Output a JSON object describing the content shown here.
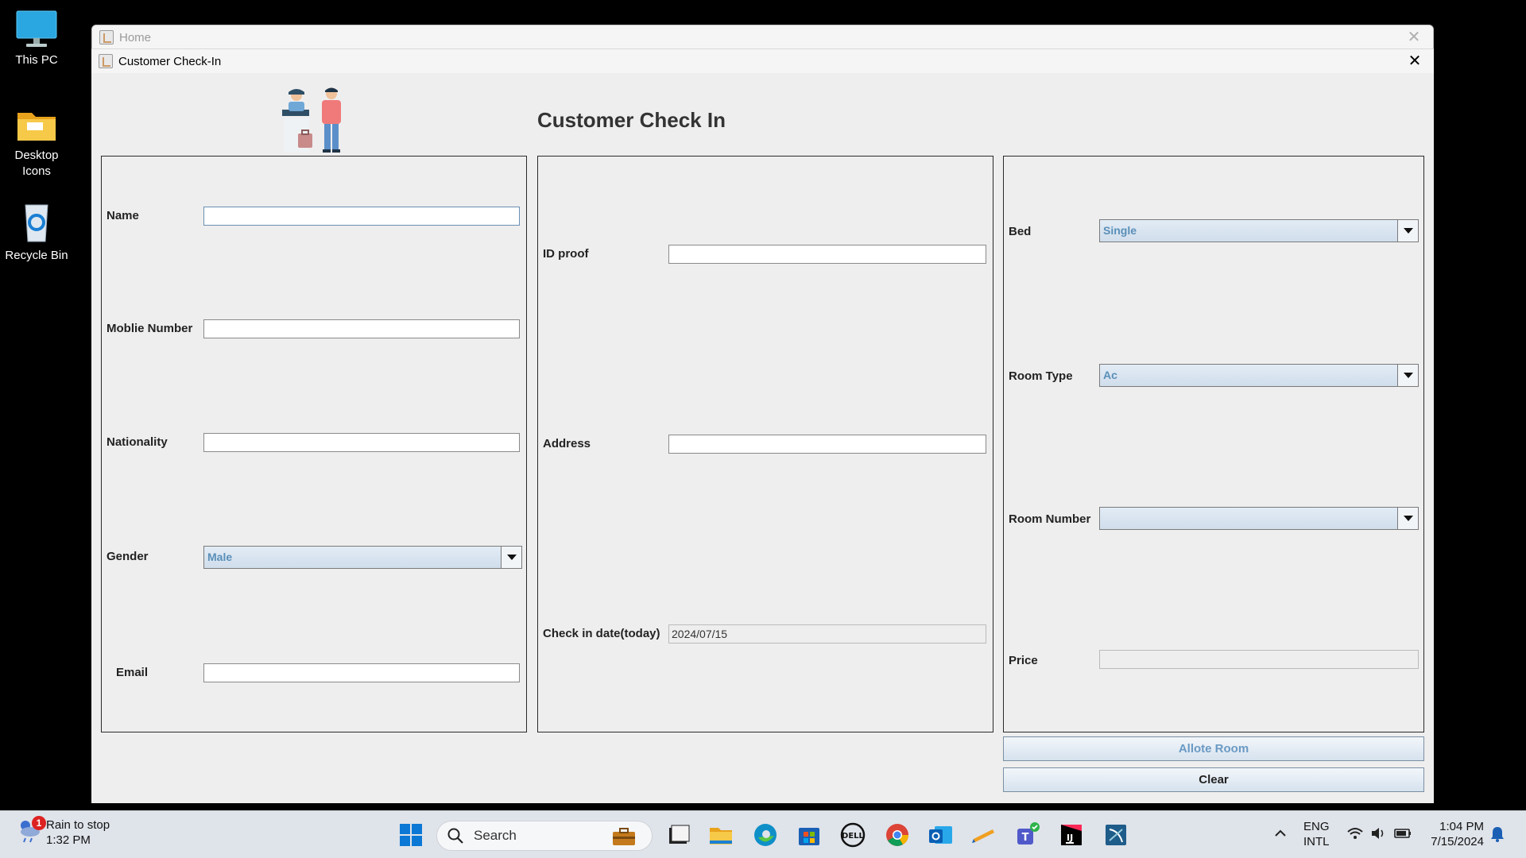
{
  "desktop": {
    "icons": [
      {
        "label": "This PC"
      },
      {
        "label": "Desktop Icons"
      },
      {
        "label": "Recycle Bin"
      }
    ]
  },
  "home_window": {
    "title": "Home"
  },
  "checkin_window": {
    "title": "Customer Check-In",
    "heading": "Customer Check In",
    "left_panel": {
      "name_label": "Name",
      "name_value": "",
      "mobile_label": "Moblie Number",
      "mobile_value": "",
      "nationality_label": "Nationality",
      "nationality_value": "",
      "gender_label": "Gender",
      "gender_value": "Male",
      "email_label": "Email",
      "email_value": ""
    },
    "middle_panel": {
      "id_proof_label": "ID proof",
      "id_proof_value": "",
      "address_label": "Address",
      "address_value": "",
      "checkin_label": "Check in date(today)",
      "checkin_value": "2024/07/15"
    },
    "right_panel": {
      "bed_label": "Bed",
      "bed_value": "Single",
      "room_type_label": "Room Type",
      "room_type_value": "Ac",
      "room_number_label": "Room Number",
      "room_number_value": "",
      "price_label": "Price",
      "price_value": ""
    },
    "buttons": {
      "allote": "Allote Room",
      "clear": "Clear"
    }
  },
  "taskbar": {
    "weather_title": "Rain to stop",
    "weather_time": "1:32 PM",
    "notification_count": "1",
    "search_placeholder": "Search",
    "apps": [
      "work-briefcase",
      "file-manager",
      "file-explorer",
      "edge",
      "microsoft-store",
      "dell",
      "chrome",
      "outlook-new",
      "pen-tool",
      "teams-new",
      "intellij",
      "mysql-workbench"
    ],
    "lang_top": "ENG",
    "lang_bottom": "INTL",
    "clock_time": "1:04 PM",
    "clock_date": "7/15/2024"
  },
  "colors": {
    "window_bg": "#eeeeee",
    "combo_text": "#5a8fb8",
    "desktop_bg": "#000000",
    "taskbar_bg": "#dfe3ea"
  }
}
